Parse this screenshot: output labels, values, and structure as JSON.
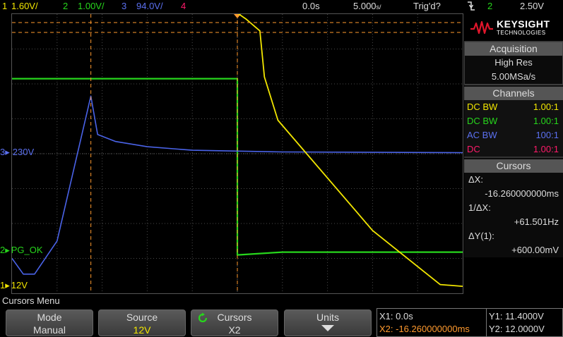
{
  "topbar": {
    "ch1": {
      "num": "1",
      "scale": "1.60V/"
    },
    "ch2": {
      "num": "2",
      "scale": "1.00V/"
    },
    "ch3": {
      "num": "3",
      "scale": "94.0V/"
    },
    "ch4": {
      "num": "4"
    },
    "time_offset": "0.0s",
    "time_scale": "5.000",
    "time_scale_unit": "s/",
    "trigger_status": "Trig'd?",
    "trigger_slope_icon": "falling-edge-icon",
    "trigger_source": "2",
    "trigger_level": "2.50V"
  },
  "colors": {
    "ch1": "#f2e600",
    "ch2": "#27d61c",
    "ch3": "#4a63e8",
    "ch4": "#ff1a6a",
    "cursor": "#ff9a2e",
    "grid": "#4a4a4a"
  },
  "markers": {
    "ch3_label": "230V",
    "ch3_num": "3",
    "ch2_label": "PG_OK",
    "ch2_num": "2",
    "ch1_label": "12V",
    "ch1_num": "1"
  },
  "panel": {
    "brand": "KEYSIGHT",
    "brand_sub": "TECHNOLOGIES",
    "acquisition_title": "Acquisition",
    "acq_mode": "High Res",
    "acq_rate": "5.00MSa/s",
    "channels_title": "Channels",
    "channels": [
      {
        "coupling": "DC BW",
        "probe": "1.00:1"
      },
      {
        "coupling": "DC BW",
        "probe": "1.00:1"
      },
      {
        "coupling": "AC BW",
        "probe": "100:1"
      },
      {
        "coupling": "DC",
        "probe": "1.00:1"
      }
    ],
    "cursors_title": "Cursors",
    "delta_x_label": "ΔX:",
    "delta_x_value": "-16.260000000ms",
    "inv_delta_x_label": "1/ΔX:",
    "inv_delta_x_value": "+61.501Hz",
    "delta_y_label": "ΔY(1):",
    "delta_y_value": "+600.00mV"
  },
  "menu": {
    "title": "Cursors Menu",
    "keys": [
      {
        "label": "Mode",
        "value": "Manual"
      },
      {
        "label": "Source",
        "value": "12V"
      },
      {
        "label": "Cursors",
        "value": "X2"
      },
      {
        "label": "Units"
      }
    ]
  },
  "readout": {
    "x1": "X1: 0.0s",
    "x2": "X2: -16.260000000ms",
    "y1": "Y1: 11.4000V",
    "y2": "Y2: 12.0000V"
  },
  "waveforms": {
    "time_divisions": 10,
    "voltage_divisions": 8,
    "trigger_time_div": 5.0,
    "cursor_x1_div": 5.0,
    "cursor_x2_div": 1.75,
    "ch1_div": [
      [
        0,
        8.03
      ],
      [
        5.0,
        8.03
      ],
      [
        5.2,
        7.85
      ],
      [
        5.5,
        7.52
      ],
      [
        5.6,
        6.2
      ],
      [
        5.9,
        4.96
      ],
      [
        8.0,
        1.8
      ],
      [
        9.5,
        0.25
      ],
      [
        10,
        0.2
      ]
    ],
    "ch2_div": [
      [
        0,
        6.15
      ],
      [
        5.0,
        6.15
      ],
      [
        5.0,
        1.1
      ],
      [
        6.0,
        1.18
      ],
      [
        10,
        1.18
      ]
    ],
    "ch3_div": [
      [
        0,
        1.0
      ],
      [
        0.25,
        0.55
      ],
      [
        0.5,
        0.55
      ],
      [
        1.0,
        1.5
      ],
      [
        1.75,
        5.65
      ],
      [
        1.9,
        4.55
      ],
      [
        2.3,
        4.35
      ],
      [
        3.0,
        4.2
      ],
      [
        4.0,
        4.1
      ],
      [
        6.0,
        4.05
      ],
      [
        10,
        4.03
      ]
    ]
  }
}
